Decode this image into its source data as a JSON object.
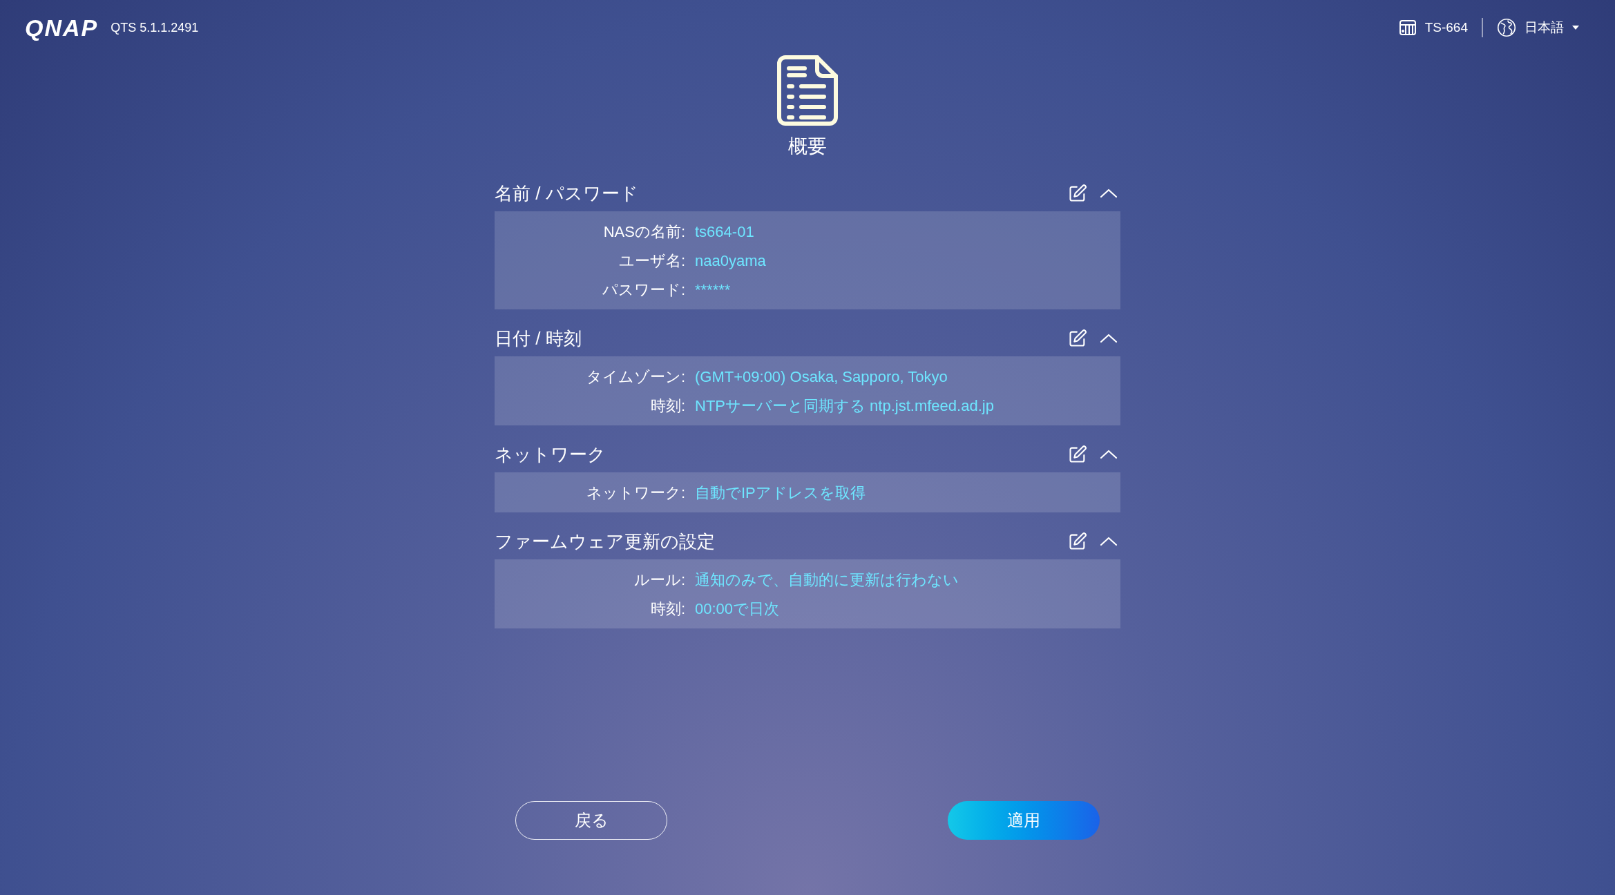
{
  "header": {
    "logo": "QNAP",
    "version": "QTS 5.1.1.2491",
    "device": "TS-664",
    "language": "日本語"
  },
  "page": {
    "title": "概要"
  },
  "sections": [
    {
      "title": "名前 / パスワード",
      "expanded": true,
      "rows": [
        {
          "label": "NASの名前:",
          "value": "ts664-01"
        },
        {
          "label": "ユーザ名:",
          "value": "naa0yama"
        },
        {
          "label": "パスワード:",
          "value": "******"
        }
      ]
    },
    {
      "title": "日付 / 時刻",
      "expanded": true,
      "rows": [
        {
          "label": "タイムゾーン:",
          "value": "(GMT+09:00) Osaka, Sapporo, Tokyo"
        },
        {
          "label": "時刻:",
          "value": "NTPサーバーと同期する ntp.jst.mfeed.ad.jp"
        }
      ]
    },
    {
      "title": "ネットワーク",
      "expanded": true,
      "rows": [
        {
          "label": "ネットワーク:",
          "value": "自動でIPアドレスを取得"
        }
      ]
    },
    {
      "title": "ファームウェア更新の設定",
      "expanded": true,
      "rows": [
        {
          "label": "ルール:",
          "value": "通知のみで、自動的に更新は行わない"
        },
        {
          "label": "時刻:",
          "value": "00:00で日次"
        }
      ]
    }
  ],
  "buttons": {
    "back": "戻る",
    "apply": "適用"
  }
}
